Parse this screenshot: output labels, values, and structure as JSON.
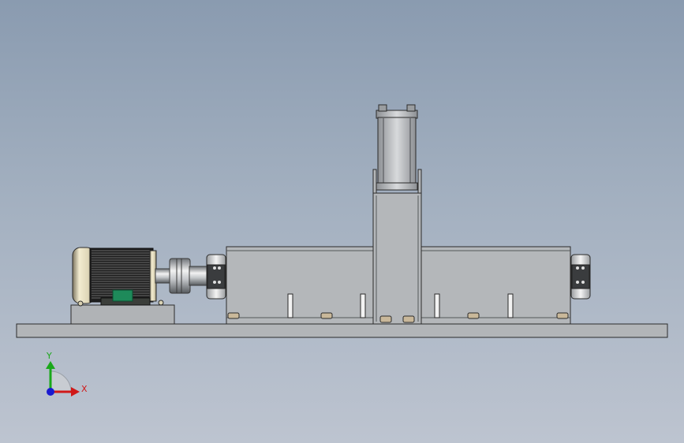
{
  "triad": {
    "y_label": "Y",
    "x_label": "X",
    "colors": {
      "x_axis": "#d01818",
      "y_axis": "#1aa81a",
      "z_axis": "#1a1ad0"
    }
  },
  "colors": {
    "background_top": "#8a9bb0",
    "background_bottom": "#bdc4d0",
    "steel": "#b4b7ba",
    "steel_edge": "#2b2b2b",
    "motor_body": "#202020",
    "motor_cap": "#d9d2b4",
    "motor_base": "#1e8a5a"
  }
}
